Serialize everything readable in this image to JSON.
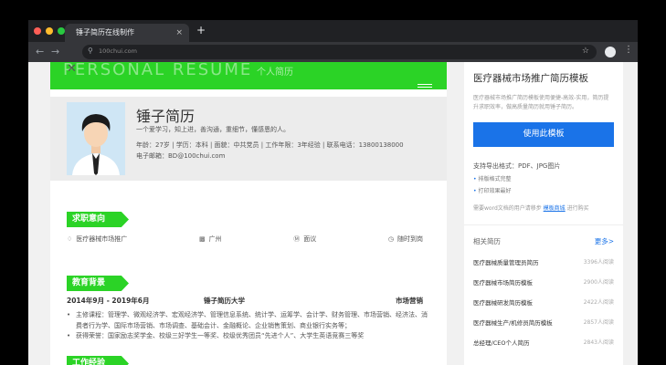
{
  "browser": {
    "tab_title": "锤子简历在线制作",
    "tab_close": "×",
    "new_tab": "+",
    "url": "100chui.com",
    "back": "←",
    "forward": "→",
    "stop": "✕",
    "star": "☆",
    "menu": "⋮",
    "colors": {
      "red": "#ff5f57",
      "yellow": "#febc2e",
      "green": "#28c840"
    }
  },
  "resume": {
    "banner_en": "PERSONAL RESUME",
    "banner_cn": "个人简历",
    "name": "锤子简历",
    "intro": "一个爱学习，知上进，善沟通，重细节，懂感恩的人。",
    "info_line1": "年龄：27岁 | 学历：本科 | 面貌：中共党员 | 工作年限：3年经验 | 联系电话：13800138000",
    "info_line2": "电子邮箱：BD@100chui.com",
    "job_section_title": "求职意向",
    "job": {
      "position": "医疗器械市场推广",
      "city": "广州",
      "salary": "面议",
      "availability": "随时到岗"
    },
    "edu_section_title": "教育背景",
    "edu": {
      "period": "2014年9月 - 2019年6月",
      "school": "锤子简历大学",
      "major": "市场营销",
      "items": [
        "主修课程：管理学、微观经济学、宏观经济学、管理信息系统、统计学、运筹学、会计学、财务管理、市场营销、经济法、消费者行为学、国际市场营销、市场调查、基础会计、金融概论、企业销售策划、商业银行实务等；",
        "获得荣誉：国家励志奖学金、校级三好学生一等奖、校级优秀团员“先进个人”、大学生英语竞赛三等奖"
      ]
    },
    "work_section_title": "工作经验"
  },
  "sidebar": {
    "title": "医疗器械市场推广简历模板",
    "desc": "医疗器械市场推广简历模板使用便捷-高效-实用，简历提升求职效率，做高质量简历就用锤子简历。",
    "use_button": "使用此模板",
    "export_label": "支持导出格式：PDF、JPG图片",
    "bullet1": "排版格式完整",
    "bullet2": "打印效果最好",
    "need_prefix": "需要word文档的用户请移步",
    "need_link": "模板商城",
    "need_suffix": "进行购买",
    "related_title": "相关简历",
    "more": "更多>",
    "related": [
      {
        "title": "医疗器械质量管理员简历",
        "count": "3396人阅读"
      },
      {
        "title": "医疗器械市场简历模板",
        "count": "2900人阅读"
      },
      {
        "title": "医疗器械研发简历模板",
        "count": "2422人阅读"
      },
      {
        "title": "医疗器械生产/机修员简历模板",
        "count": "2857人阅读"
      },
      {
        "title": "总经理/CEO个人简历",
        "count": "2843人阅读"
      }
    ]
  }
}
